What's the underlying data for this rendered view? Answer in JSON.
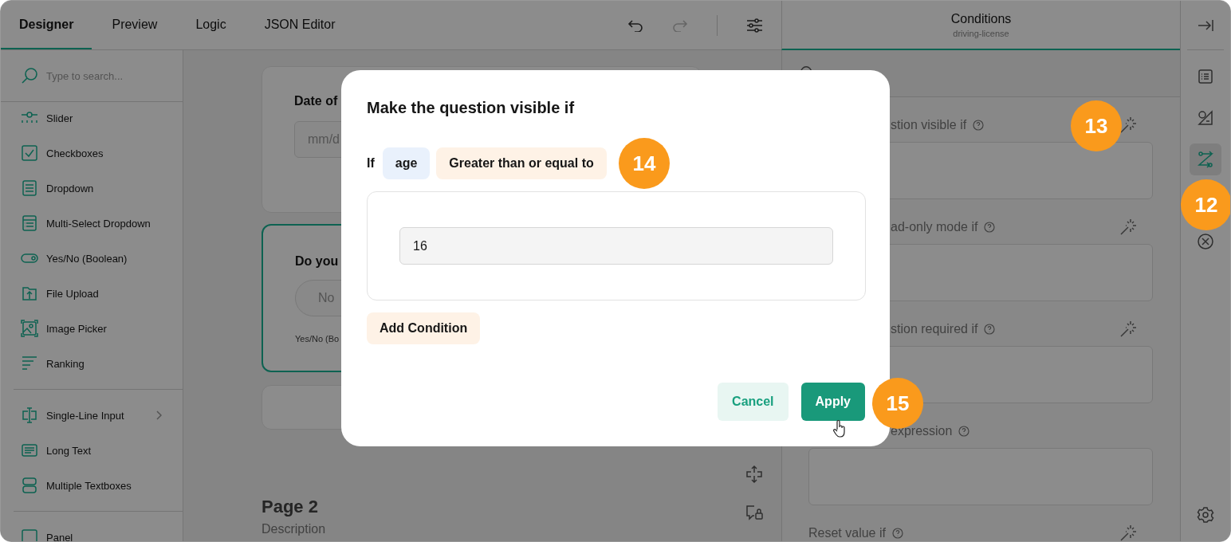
{
  "tabs": [
    {
      "label": "Designer",
      "selected": true
    },
    {
      "label": "Preview",
      "selected": false
    },
    {
      "label": "Logic",
      "selected": false
    },
    {
      "label": "JSON Editor",
      "selected": false
    }
  ],
  "toolbar": {
    "undo": {
      "disabled": false
    },
    "redo": {
      "disabled": true
    }
  },
  "toolbox": {
    "search_placeholder": "Type to search...",
    "groups": [
      [
        {
          "label": "Slider",
          "submenu": false
        },
        {
          "label": "Checkboxes",
          "submenu": false
        },
        {
          "label": "Dropdown",
          "submenu": false
        },
        {
          "label": "Multi-Select Dropdown",
          "submenu": false
        },
        {
          "label": "Yes/No (Boolean)",
          "submenu": false
        },
        {
          "label": "File Upload",
          "submenu": false
        },
        {
          "label": "Image Picker",
          "submenu": false
        },
        {
          "label": "Ranking",
          "submenu": false
        }
      ],
      [
        {
          "label": "Single-Line Input",
          "submenu": true
        },
        {
          "label": "Long Text",
          "submenu": false
        },
        {
          "label": "Multiple Textboxes",
          "submenu": false
        }
      ],
      [
        {
          "label": "Panel",
          "submenu": false
        }
      ]
    ]
  },
  "canvas": {
    "questions": [
      {
        "kind": "date",
        "title": "Date of",
        "placeholder": "mm/d",
        "selected": false
      },
      {
        "kind": "boolean",
        "title": "Do you",
        "option": "No",
        "type_label": "Yes/No (Bo",
        "selected": true
      },
      {
        "kind": "empty",
        "selected": false
      }
    ],
    "page": {
      "title": "Page 2",
      "description": "Description"
    }
  },
  "property_panel": {
    "title": "Conditions",
    "subtitle": "driving-license",
    "properties": [
      {
        "label": "stion visible if",
        "wand": true
      },
      {
        "label": "ad-only mode if",
        "wand": true
      },
      {
        "label": "stion required if",
        "wand": true
      },
      {
        "label": "expression",
        "wand": false
      },
      {
        "label": "Reset value if",
        "wand": true
      }
    ]
  },
  "side_tabs": [
    {
      "selected": false
    },
    {
      "selected": false
    },
    {
      "selected": true
    },
    {
      "selected": false
    }
  ],
  "dialog": {
    "title": "Make the question visible if",
    "if_label": "If",
    "field": "age",
    "operator": "Greater than or equal to",
    "value": "16",
    "add_button": "Add Condition",
    "cancel_button": "Cancel",
    "apply_button": "Apply"
  },
  "callouts": [
    {
      "label": "13"
    },
    {
      "label": "12"
    },
    {
      "label": "14"
    },
    {
      "label": "15"
    }
  ]
}
